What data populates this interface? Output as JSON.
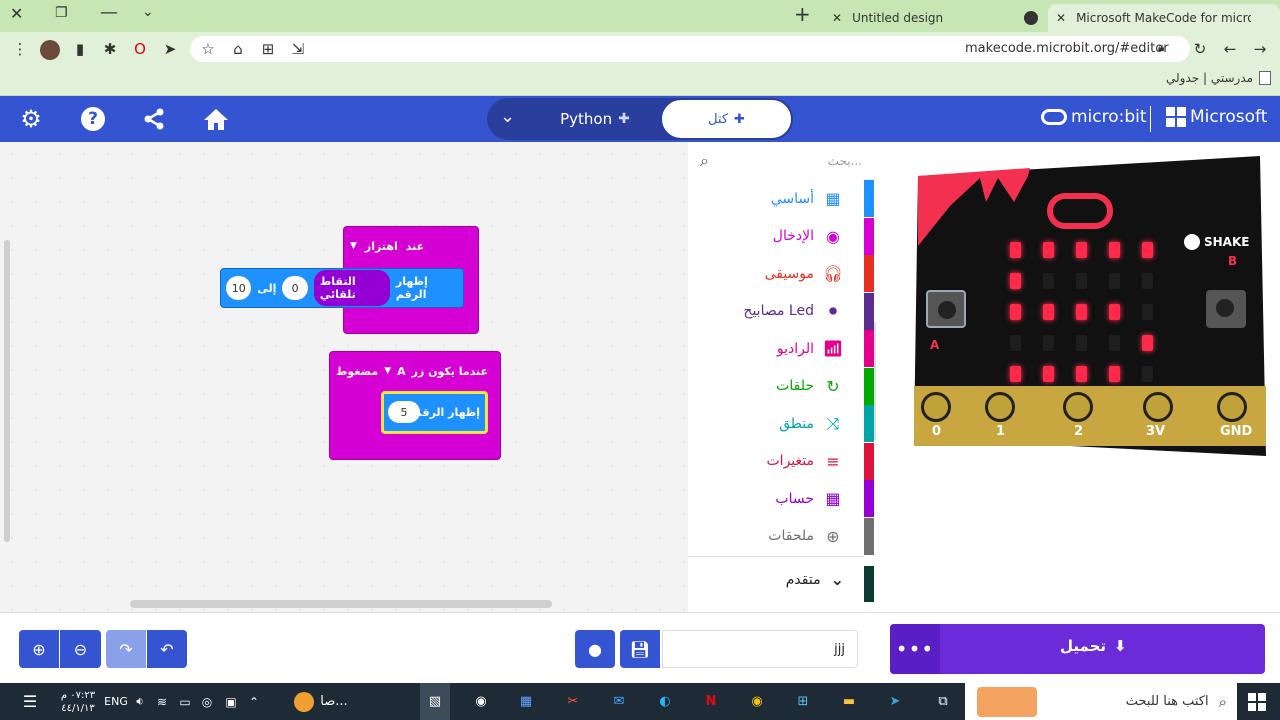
{
  "browser": {
    "tabs": [
      {
        "title": "Untitled design",
        "icon": "canva-icon"
      },
      {
        "title": "Microsoft MakeCode for micro:bit",
        "icon": "makecode-icon"
      }
    ],
    "url": "makecode.microbit.org/#editor",
    "bookmark": "مدرستي | جدولي"
  },
  "header": {
    "brand_microbit": "micro:bit",
    "brand_microsoft": "Microsoft",
    "toggle_blocks": "كتل",
    "toggle_python": "Python"
  },
  "toolbox": {
    "search_placeholder": "بحث...",
    "categories": [
      {
        "label": "أساسي",
        "color": "#1e90ff",
        "icon": "grid-icon"
      },
      {
        "label": "الإدخال",
        "color": "#d400d4",
        "icon": "input-icon"
      },
      {
        "label": "موسيقى",
        "color": "#e63022",
        "icon": "headphones-icon"
      },
      {
        "label": "مصابيح Led",
        "color": "#5c2d91",
        "icon": "toggle-icon"
      },
      {
        "label": "الراديو",
        "color": "#e3008c",
        "icon": "signal-icon"
      },
      {
        "label": "حلقات",
        "color": "#00aa00",
        "icon": "loop-icon"
      },
      {
        "label": "منطق",
        "color": "#00a4a6",
        "icon": "shuffle-icon"
      },
      {
        "label": "متغيرات",
        "color": "#dc143c",
        "icon": "lines-icon"
      },
      {
        "label": "حساب",
        "color": "#9400d3",
        "icon": "calculator-icon"
      },
      {
        "label": "ملحقات",
        "color": "#707070",
        "icon": "plus-circle-icon"
      }
    ],
    "advanced": "متقدم"
  },
  "blocks": {
    "shake_event": "عند",
    "shake_gesture": "اهتزاز",
    "show_number_1": "إظهار الرقم",
    "pick_random": "التقاط تلقائي",
    "random_from": "0",
    "random_to_label": "إلى",
    "random_to": "10",
    "button_event": "عندما يكون زر",
    "button_name": "A",
    "button_state": "مضغوط",
    "show_number_2": "إظهار الرقم",
    "number_value": "5"
  },
  "simulator": {
    "shake_label": "SHAKE",
    "button_a": "A",
    "button_b": "B",
    "pins": [
      "0",
      "1",
      "2",
      "3V",
      "GND"
    ],
    "led_matrix": [
      [
        1,
        1,
        1,
        1,
        1
      ],
      [
        1,
        0,
        0,
        0,
        0
      ],
      [
        1,
        1,
        1,
        1,
        0
      ],
      [
        0,
        0,
        0,
        0,
        1
      ],
      [
        1,
        1,
        1,
        1,
        0
      ]
    ]
  },
  "bottom": {
    "download_label": "تحميل",
    "project_name": "jjj"
  },
  "taskbar": {
    "search_placeholder": "اكتب هنا للبحث",
    "language": "ENG",
    "time": "٠٧:٢٣ م",
    "date": "٤٤/١/١٣",
    "open_app_label": "صا..."
  },
  "colors": {
    "primary": "#3454d1",
    "event_block": "#d400d4",
    "basic_block": "#1e90ff",
    "download": "#6c2bd9"
  }
}
